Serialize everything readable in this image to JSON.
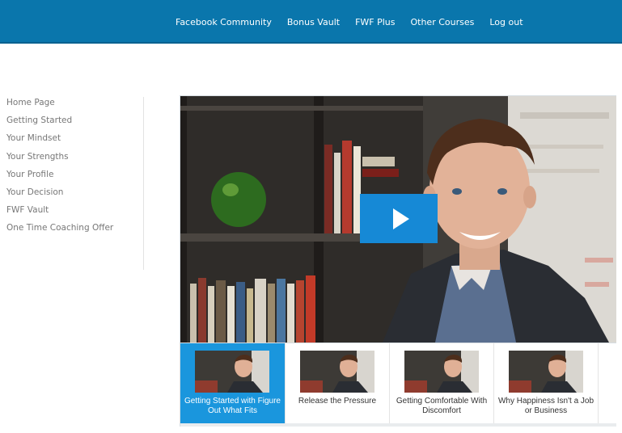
{
  "topnav": {
    "items": [
      "Facebook Community",
      "Bonus Vault",
      "FWF Plus",
      "Other Courses",
      "Log out"
    ]
  },
  "sidebar": {
    "items": [
      "Home Page",
      "Getting Started",
      "Your Mindset",
      "Your Strengths",
      "Your Profile",
      "Your Decision",
      "FWF Vault",
      "One Time Coaching Offer"
    ]
  },
  "player": {
    "play_icon": "play-icon",
    "playlist": [
      {
        "title": "Getting Started with Figure Out What Fits",
        "active": true
      },
      {
        "title": "Release the Pressure",
        "active": false
      },
      {
        "title": "Getting Comfortable With Discomfort",
        "active": false
      },
      {
        "title": "Why Happiness Isn't a Job or Business",
        "active": false
      }
    ]
  },
  "colors": {
    "topbar": "#0a76ac",
    "play_button": "#1689d6",
    "active_thumb": "#1a96dd",
    "sidebar_text": "#777777"
  }
}
